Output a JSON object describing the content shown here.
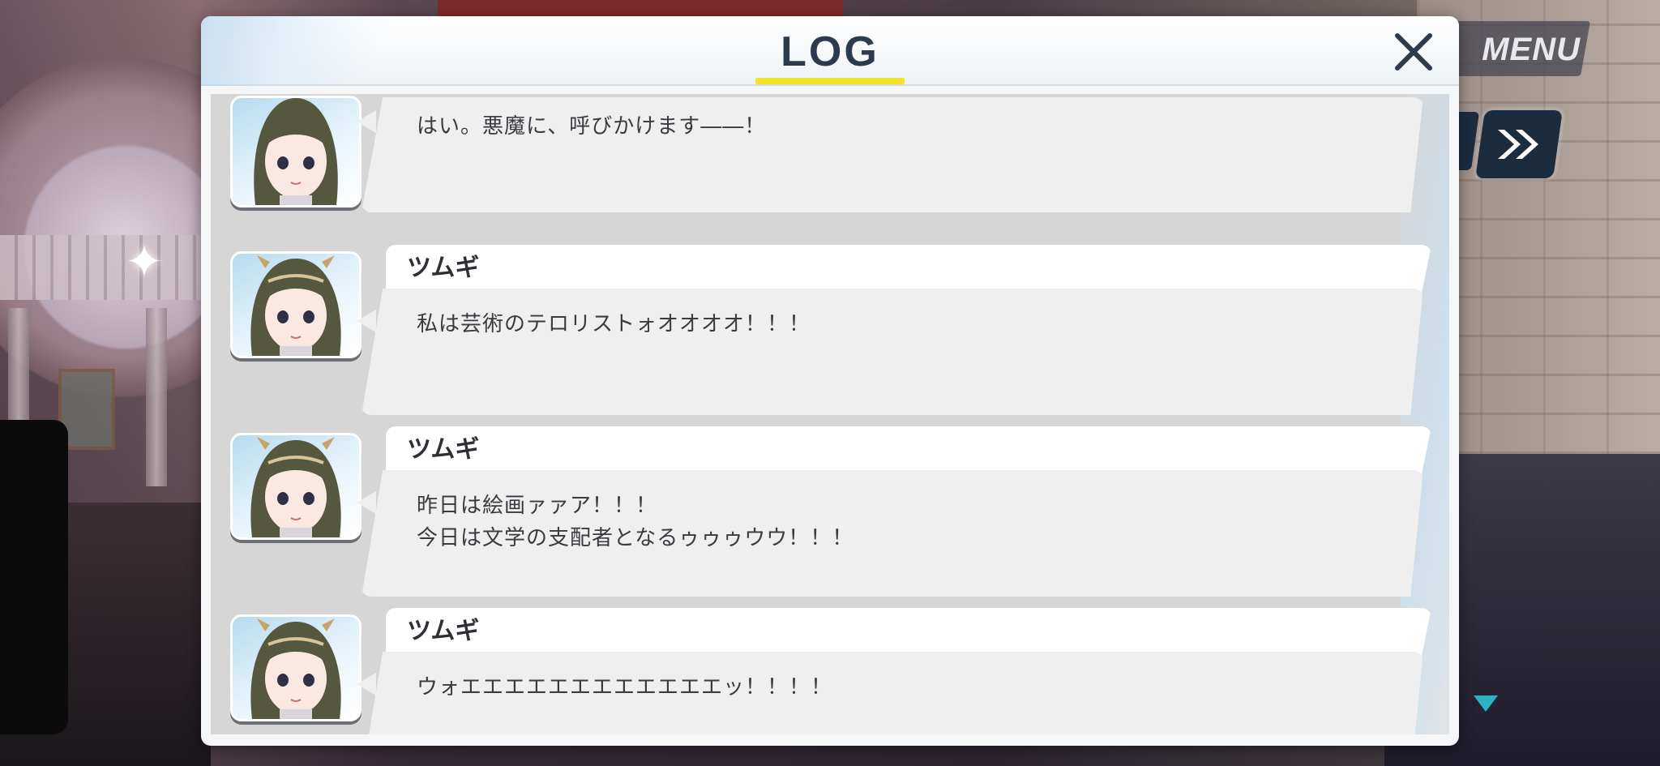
{
  "menu": {
    "label": "MENU"
  },
  "log": {
    "title": "LOG",
    "close_icon": "close-icon",
    "entries": [
      {
        "speaker": "",
        "lines": [
          "はい。悪魔に、呼びかけます――！"
        ]
      },
      {
        "speaker": "ツムギ",
        "lines": [
          "私は芸術のテロリストォオオオオ！！！"
        ]
      },
      {
        "speaker": "ツムギ",
        "lines": [
          "昨日は絵画ァァア！！！",
          "今日は文学の支配者となるゥゥゥウウ！！！"
        ]
      },
      {
        "speaker": "ツムギ",
        "lines": [
          "ウォエエエエエエエエエエエエッ！！！！"
        ]
      }
    ]
  },
  "colors": {
    "title_text": "#2d3a4d",
    "title_underline": "#f2e42a",
    "button_dark": "#1c2c3f",
    "scroll_arrow": "#2bb3c3"
  },
  "icons": {
    "fast_forward": "fast-forward-icon",
    "sparkle": "sparkle-icon",
    "scroll_down": "scroll-down-icon"
  }
}
